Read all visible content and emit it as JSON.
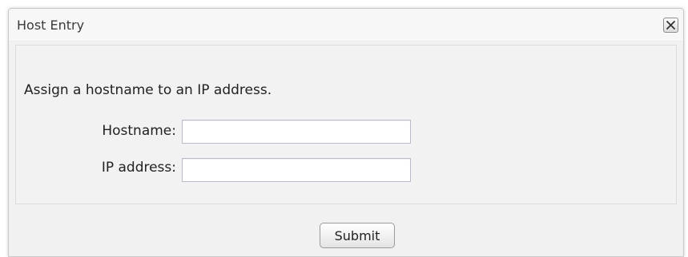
{
  "dialog": {
    "title": "Host Entry",
    "close_icon": "close-icon"
  },
  "form": {
    "intro": "Assign a hostname to an IP address.",
    "hostname_label": "Hostname:",
    "hostname_value": "",
    "ip_label": "IP address:",
    "ip_value": ""
  },
  "footer": {
    "submit_label": "Submit"
  },
  "colors": {
    "dialog_background": "#f1f1f1",
    "panel_border": "#dcdcdc",
    "input_border": "#b9b9c9"
  }
}
